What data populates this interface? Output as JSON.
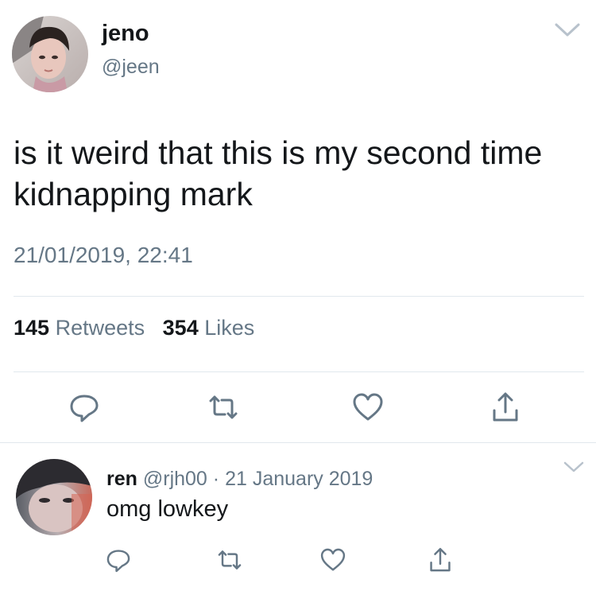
{
  "main_tweet": {
    "display_name": "jeno",
    "handle": "@jeen",
    "text": "is it weird that this is my second time kidnapping mark",
    "timestamp": "21/01/2019, 22:41",
    "retweets_count": "145",
    "retweets_label": "Retweets",
    "likes_count": "354",
    "likes_label": "Likes",
    "actions": [
      "reply-icon",
      "retweet-icon",
      "like-icon",
      "share-icon"
    ]
  },
  "reply": {
    "display_name": "ren",
    "handle": "@rjh00",
    "separator": "·",
    "date": "21 January 2019",
    "text": "omg lowkey",
    "actions": [
      "reply-icon",
      "retweet-icon",
      "like-icon",
      "share-icon"
    ]
  },
  "colors": {
    "text_primary": "#14171a",
    "text_secondary": "#657786",
    "divider": "#e1e8ed",
    "icon": "#657786"
  }
}
